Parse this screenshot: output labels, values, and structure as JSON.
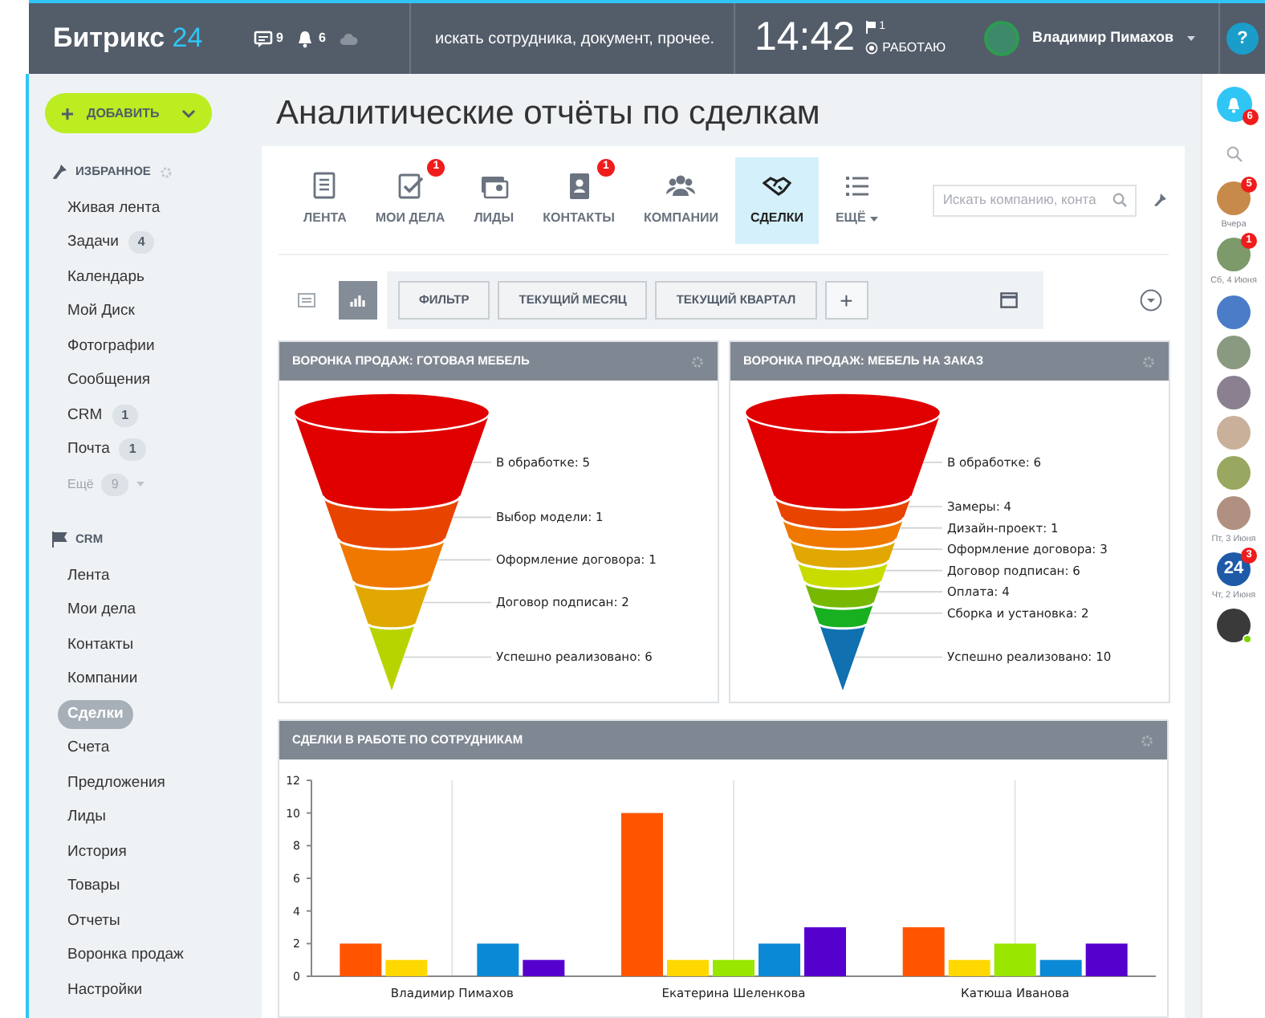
{
  "header": {
    "logo": {
      "text": "Битрикс",
      "accent": "24"
    },
    "counters": [
      {
        "kind": "chat",
        "count": "9"
      },
      {
        "kind": "bell",
        "count": "6"
      },
      {
        "kind": "cloud"
      }
    ],
    "search": {
      "placeholder": "искать сотрудника, документ, прочее."
    },
    "time": "14:42",
    "flag_count": "1",
    "status": "РАБОТАЮ",
    "user_name": "Владимир Пимахов",
    "help": "?"
  },
  "sidebar": {
    "add_button": "ДОБАВИТЬ",
    "sections": [
      {
        "kind": "favorites",
        "title": "ИЗБРАННОЕ",
        "items": [
          {
            "label": "Живая лента",
            "selected": false
          },
          {
            "label": "Задачи",
            "badge": "4",
            "selected": false
          },
          {
            "label": "Календарь",
            "selected": false
          },
          {
            "label": "Мой Диск",
            "selected": false
          },
          {
            "label": "Фотографии",
            "selected": false
          },
          {
            "label": "Сообщения",
            "selected": false
          },
          {
            "label": "CRM",
            "badge": "1",
            "selected": false
          },
          {
            "label": "Почта",
            "badge": "1",
            "selected": false
          }
        ],
        "more": {
          "label": "Ещё",
          "badge": "9"
        }
      },
      {
        "kind": "crm",
        "title": "CRM",
        "items": [
          {
            "label": "Лента",
            "selected": false
          },
          {
            "label": "Мои дела",
            "selected": false
          },
          {
            "label": "Контакты",
            "selected": false
          },
          {
            "label": "Компании",
            "selected": false
          },
          {
            "label": "Сделки",
            "selected": true
          },
          {
            "label": "Счета",
            "selected": false
          },
          {
            "label": "Предложения",
            "selected": false
          },
          {
            "label": "Лиды",
            "selected": false
          },
          {
            "label": "История",
            "selected": false
          },
          {
            "label": "Товары",
            "selected": false
          },
          {
            "label": "Отчеты",
            "selected": false
          },
          {
            "label": "Воронка продаж",
            "selected": false
          },
          {
            "label": "Настройки",
            "selected": false
          }
        ]
      }
    ]
  },
  "page_title": "Аналитические отчёты по сделкам",
  "crm_tabs": [
    {
      "kind": "feed",
      "label": "ЛЕНТА",
      "selected": false
    },
    {
      "kind": "tasks",
      "label": "МОИ ДЕЛА",
      "badge": "1",
      "selected": false
    },
    {
      "kind": "leads",
      "label": "ЛИДЫ",
      "selected": false
    },
    {
      "kind": "contacts",
      "label": "КОНТАКТЫ",
      "badge": "1",
      "selected": false
    },
    {
      "kind": "companies",
      "label": "КОМПАНИИ",
      "selected": false
    },
    {
      "kind": "deals",
      "label": "СДЕЛКИ",
      "selected": true
    },
    {
      "kind": "more",
      "label": "ЕЩЁ",
      "selected": false
    }
  ],
  "crm_search": {
    "placeholder": "Искать компанию, конта"
  },
  "view_toggle": [
    {
      "kind": "list",
      "selected": false
    },
    {
      "kind": "chart",
      "selected": true
    }
  ],
  "filter_buttons": [
    "ФИЛЬТР",
    "ТЕКУЩИЙ МЕСЯЦ",
    "ТЕКУЩИЙ КВАРТАЛ"
  ],
  "add_filter": "+",
  "funnels": [
    {
      "title": "ВОРОНКА ПРОДАЖ: ГОТОВАЯ МЕБЕЛЬ",
      "stages": [
        {
          "label": "В обработке: 5",
          "color": "#e00000"
        },
        {
          "label": "Выбор модели: 1",
          "color": "#e84400"
        },
        {
          "label": "Оформление договора: 1",
          "color": "#f07800"
        },
        {
          "label": "Договор подписан: 2",
          "color": "#e0a800"
        },
        {
          "label": "Успешно реализовано: 6",
          "color": "#b8d400"
        }
      ]
    },
    {
      "title": "ВОРОНКА ПРОДАЖ: МЕБЕЛЬ НА ЗАКАЗ",
      "stages": [
        {
          "label": "В обработке: 6",
          "color": "#e00000"
        },
        {
          "label": "Замеры: 4",
          "color": "#e84400"
        },
        {
          "label": "Дизайн-проект: 1",
          "color": "#f07800"
        },
        {
          "label": "Оформление договора: 3",
          "color": "#e0a800"
        },
        {
          "label": "Договор подписан: 6",
          "color": "#c8dc00"
        },
        {
          "label": "Оплата: 4",
          "color": "#78b800"
        },
        {
          "label": "Сборка и установка: 2",
          "color": "#18b020"
        },
        {
          "label": "Успешно реализовано: 10",
          "color": "#1070b0"
        }
      ]
    }
  ],
  "bar_report": {
    "title": "СДЕЛКИ В РАБОТЕ ПО СОТРУДНИКАМ",
    "chart_data": {
      "type": "bar",
      "categories": [
        "Владимир Пимахов",
        "Екатерина Шеленкова",
        "Катюша Иванова"
      ],
      "series": [
        {
          "color": "#ff5500",
          "values": [
            2,
            10,
            3
          ]
        },
        {
          "color": "#ffd800",
          "values": [
            1,
            1,
            1
          ]
        },
        {
          "color": "#99e600",
          "values": [
            0,
            1,
            2
          ]
        },
        {
          "color": "#0a8ad6",
          "values": [
            2,
            2,
            1
          ]
        },
        {
          "color": "#5500cc",
          "values": [
            1,
            3,
            2
          ]
        }
      ],
      "grid": true,
      "ylim": [
        0,
        12
      ],
      "yticks": [
        0,
        2,
        4,
        6,
        8,
        10,
        12
      ]
    }
  },
  "right_bar": {
    "notifications_badge": "6",
    "items": [
      {
        "kind": "avatar",
        "badge": "5",
        "date": "Вчера"
      },
      {
        "kind": "avatar",
        "badge": "1",
        "date": "Сб, 4 Июня"
      },
      {
        "kind": "avatar"
      },
      {
        "kind": "avatar"
      },
      {
        "kind": "avatar"
      },
      {
        "kind": "avatar"
      },
      {
        "kind": "avatar"
      },
      {
        "kind": "avatar",
        "date": "Пт, 3 Июня"
      },
      {
        "kind": "logo",
        "text": "24",
        "badge": "3",
        "date": "Чт, 2 Июня"
      },
      {
        "kind": "avatar",
        "online": true
      }
    ]
  }
}
